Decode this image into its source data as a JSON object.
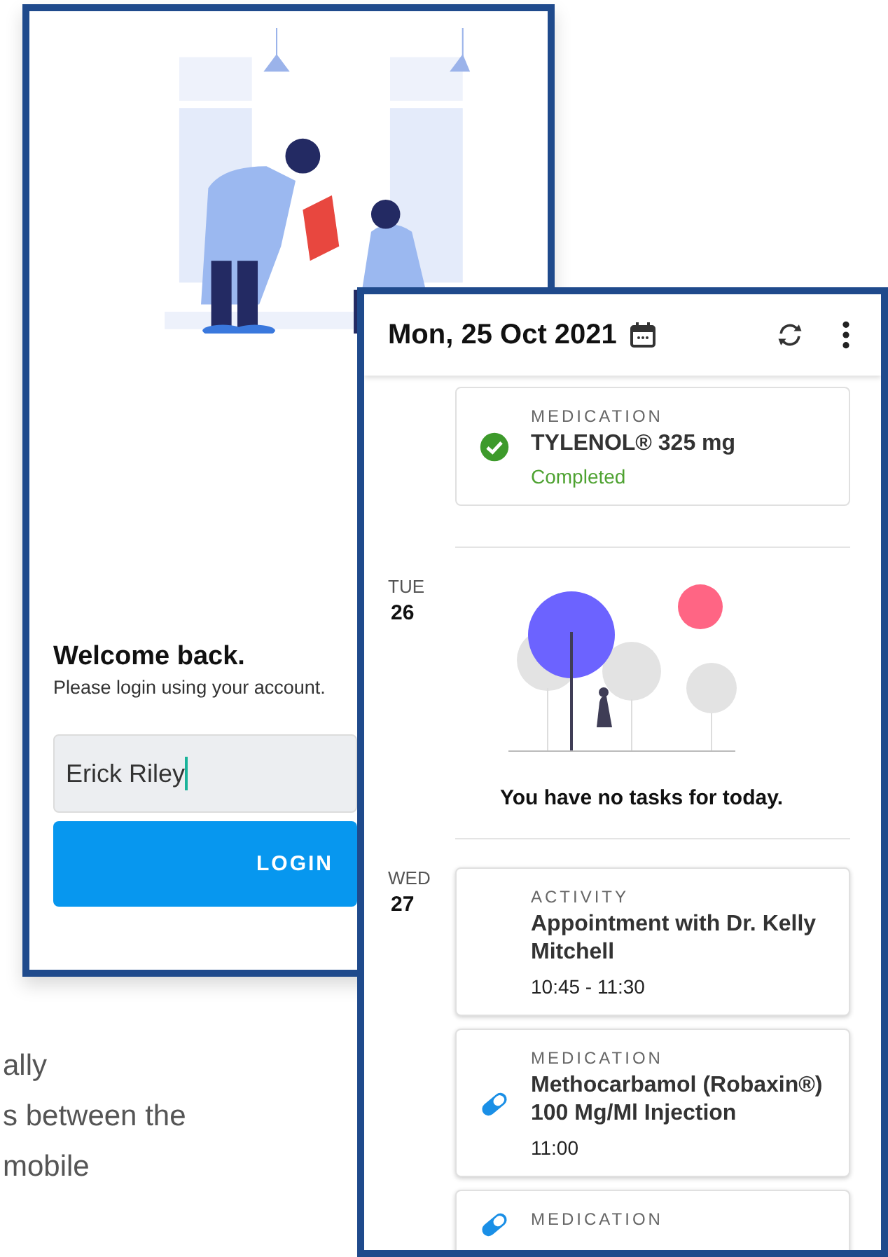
{
  "login_screen": {
    "heading": "Welcome back.",
    "subheading": "Please login using your account.",
    "username_field": {
      "value": "Erick Riley"
    },
    "login_button": "LOGIN"
  },
  "caption_lines": [
    "ally",
    "s between the",
    "mobile"
  ],
  "schedule_screen": {
    "date_title": "Mon, 25 Oct 2021",
    "days": [
      {
        "tasks": [
          {
            "kind": "medication",
            "category": "MEDICATION",
            "title": "TYLENOL® 325 mg",
            "status": "Completed",
            "completed": true
          }
        ]
      },
      {
        "weekday": "TUE",
        "day": "26",
        "empty_message": "You have no tasks for today."
      },
      {
        "weekday": "WED",
        "day": "27",
        "tasks": [
          {
            "kind": "activity",
            "category": "ACTIVITY",
            "title": "Appointment with Dr. Kelly Mitchell",
            "time": "10:45 - 11:30",
            "completed": false
          },
          {
            "kind": "medication",
            "category": "MEDICATION",
            "title": "Methocarbamol (Robaxin®) 100 Mg/Ml Injection",
            "time": "11:00",
            "completed": false
          },
          {
            "kind": "medication",
            "category": "MEDICATION",
            "completed": false
          }
        ]
      }
    ]
  }
}
